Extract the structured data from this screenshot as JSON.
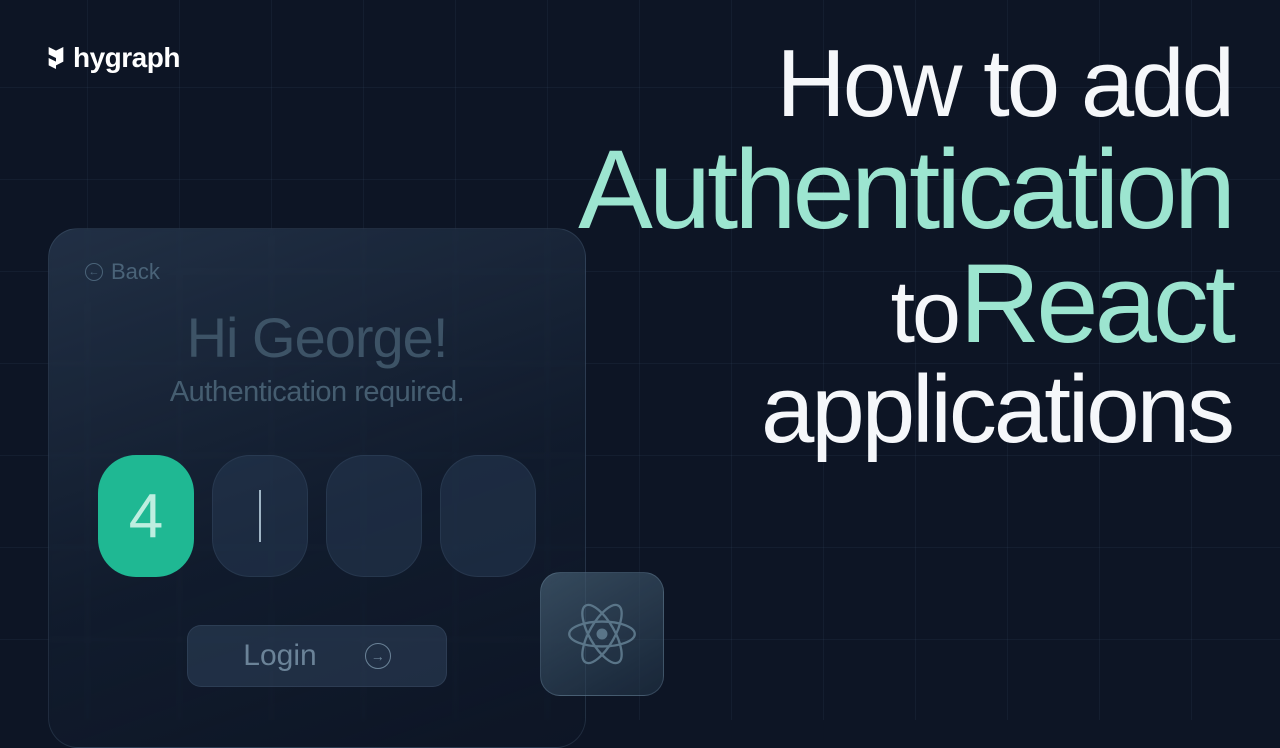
{
  "logo": {
    "text": "hygraph"
  },
  "title": {
    "l1a": "How to add",
    "l2a": "Authentication",
    "l3a": "to",
    "l3b": "React",
    "l4a": "applications"
  },
  "card": {
    "back": "Back",
    "greeting": "Hi George!",
    "subtitle": "Authentication required.",
    "pin": {
      "first": "4"
    },
    "login": "Login"
  },
  "colors": {
    "accent": "#9ce5d0",
    "pinFill": "#1fb893",
    "bg": "#0d1525"
  }
}
